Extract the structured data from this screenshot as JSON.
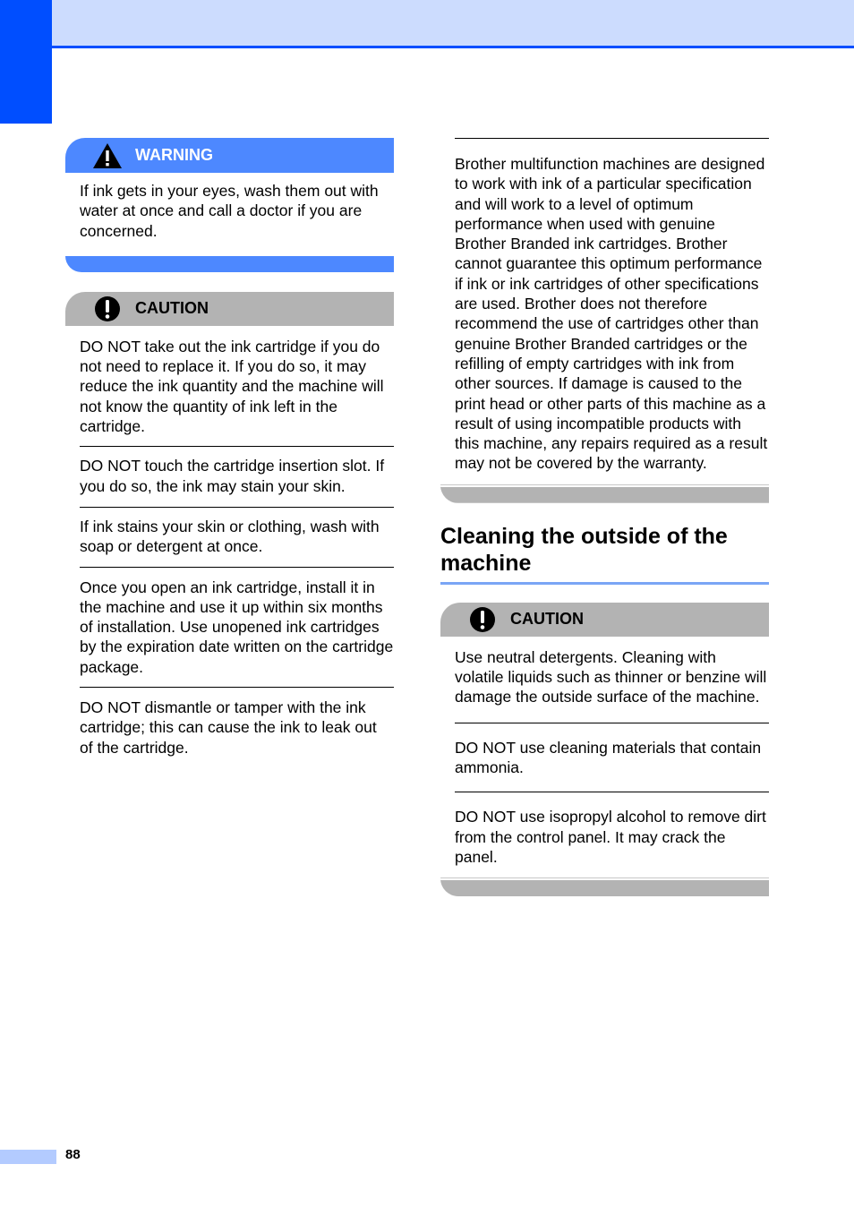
{
  "colors": {
    "accent_blue": "#004eff",
    "header_band": "#ccdcfe",
    "warning_bar": "#4d88ff",
    "caution_bar": "#b3b3b3",
    "title_rule": "#7aa5f5",
    "page_number_bar": "#b3cbff"
  },
  "left": {
    "warning": {
      "icon": "warning-triangle-icon",
      "label": "WARNING",
      "text": "If ink gets in your eyes, wash them out with water at once and call a doctor if you are concerned."
    },
    "caution": {
      "icon": "exclamation-circle-icon",
      "label": "CAUTION",
      "items": [
        "DO NOT take out the ink cartridge if you do not need to replace it. If you do so, it may reduce the ink quantity and the machine will not know the quantity of ink left in the cartridge.",
        "DO NOT touch the cartridge insertion slot. If you do so, the ink may stain your skin.",
        "If ink stains your skin or clothing, wash with soap or detergent at once.",
        "Once you open an ink cartridge, install it in the machine and use it up within six months of installation. Use unopened ink cartridges by the expiration date written on the cartridge package.",
        "DO NOT dismantle or tamper with the ink cartridge; this can cause the ink to leak out of the cartridge."
      ]
    }
  },
  "right": {
    "continued_text": "Brother multifunction machines are designed to work with ink of a particular specification and will work to a level of optimum performance when used with genuine Brother Branded ink cartridges. Brother cannot guarantee this optimum performance if ink or ink cartridges of other specifications are used. Brother does not therefore recommend the use of cartridges other than genuine Brother Branded cartridges or the refilling of empty cartridges with ink from other sources. If damage is caused to the print head or other parts of this machine as a result of using incompatible products with this machine, any repairs required as a result may not be covered by the warranty.",
    "section_title": "Cleaning the outside of the machine",
    "caution": {
      "icon": "exclamation-circle-icon",
      "label": "CAUTION",
      "items": [
        "Use neutral detergents. Cleaning with volatile liquids such as thinner or benzine will damage the outside surface of the machine.",
        "DO NOT use cleaning materials that contain ammonia.",
        "DO NOT use isopropyl alcohol to remove dirt from the control panel. It may crack the panel."
      ]
    }
  },
  "footer": {
    "page_number": "88"
  }
}
